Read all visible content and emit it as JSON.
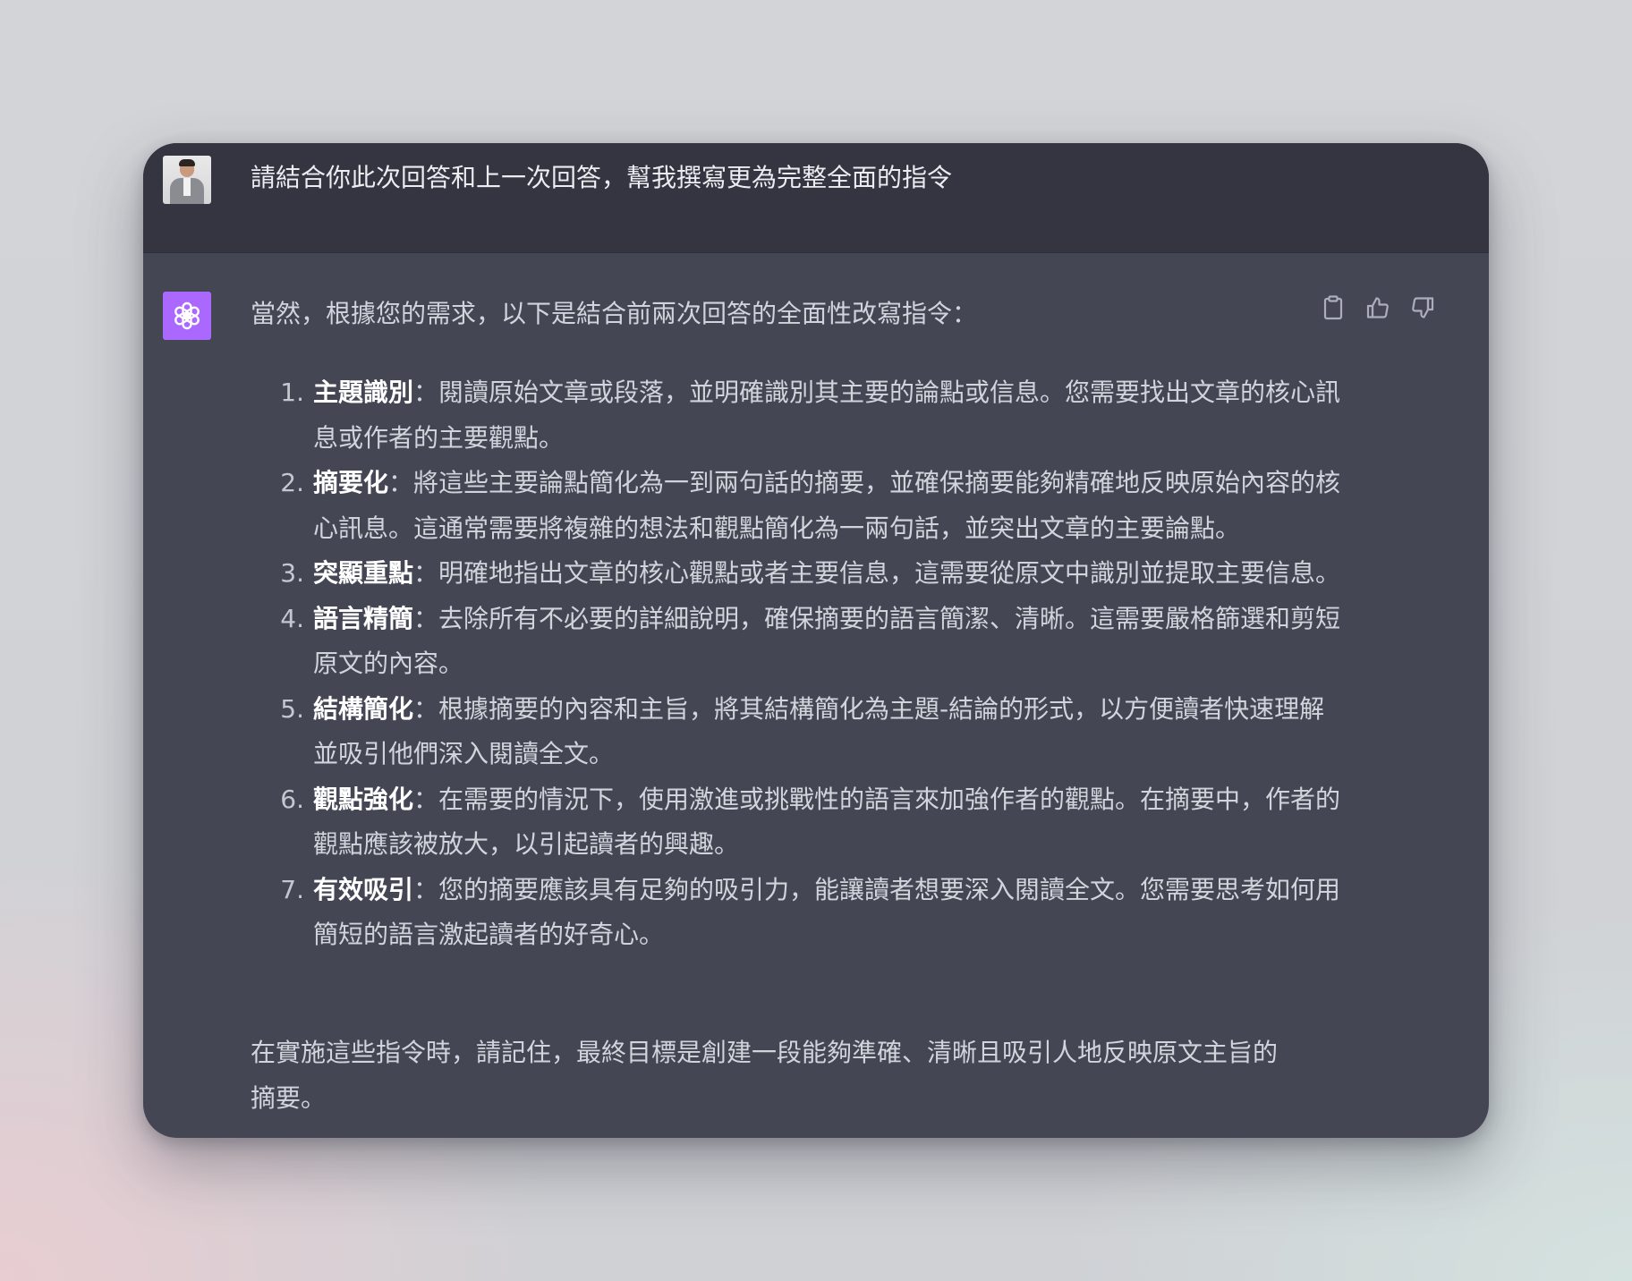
{
  "conversation": {
    "user_message": "請結合你此次回答和上一次回答，幫我撰寫更為完整全面的指令",
    "assistant": {
      "intro": "當然，根據您的需求，以下是結合前兩次回答的全面性改寫指令：",
      "items": [
        {
          "num": "1.",
          "term": "主題識別",
          "sep": "：",
          "text": "閱讀原始文章或段落，並明確識別其主要的論點或信息。您需要找出文章的核心訊息或作者的主要觀點。"
        },
        {
          "num": "2.",
          "term": "摘要化",
          "sep": "：",
          "text": "將這些主要論點簡化為一到兩句話的摘要，並確保摘要能夠精確地反映原始內容的核心訊息。這通常需要將複雜的想法和觀點簡化為一兩句話，並突出文章的主要論點。"
        },
        {
          "num": "3.",
          "term": "突顯重點",
          "sep": "：",
          "text": "明確地指出文章的核心觀點或者主要信息，這需要從原文中識別並提取主要信息。"
        },
        {
          "num": "4.",
          "term": "語言精簡",
          "sep": "：",
          "text": "去除所有不必要的詳細說明，確保摘要的語言簡潔、清晰。這需要嚴格篩選和剪短原文的內容。"
        },
        {
          "num": "5.",
          "term": "結構簡化",
          "sep": "：",
          "text": "根據摘要的內容和主旨，將其結構簡化為主題-結論的形式，以方便讀者快速理解並吸引他們深入閱讀全文。"
        },
        {
          "num": "6.",
          "term": "觀點強化",
          "sep": "：",
          "text": "在需要的情況下，使用激進或挑戰性的語言來加強作者的觀點。在摘要中，作者的觀點應該被放大，以引起讀者的興趣。"
        },
        {
          "num": "7.",
          "term": "有效吸引",
          "sep": "：",
          "text": "您的摘要應該具有足夠的吸引力，能讓讀者想要深入閱讀全文。您需要思考如何用簡短的語言激起讀者的好奇心。"
        }
      ],
      "outro": "在實施這些指令時，請記住，最終目標是創建一段能夠準確、清晰且吸引人地反映原文主旨的摘要。"
    }
  },
  "icons": {
    "copy": "clipboard-icon",
    "like": "thumbs-up-icon",
    "dislike": "thumbs-down-icon",
    "assistant_logo": "openai-logo-icon"
  },
  "colors": {
    "assistant_avatar_bg": "#ab68ff",
    "user_row_bg": "#343541",
    "assistant_row_bg": "#444654",
    "text": "#d1d5db",
    "term_text": "#ffffff"
  }
}
